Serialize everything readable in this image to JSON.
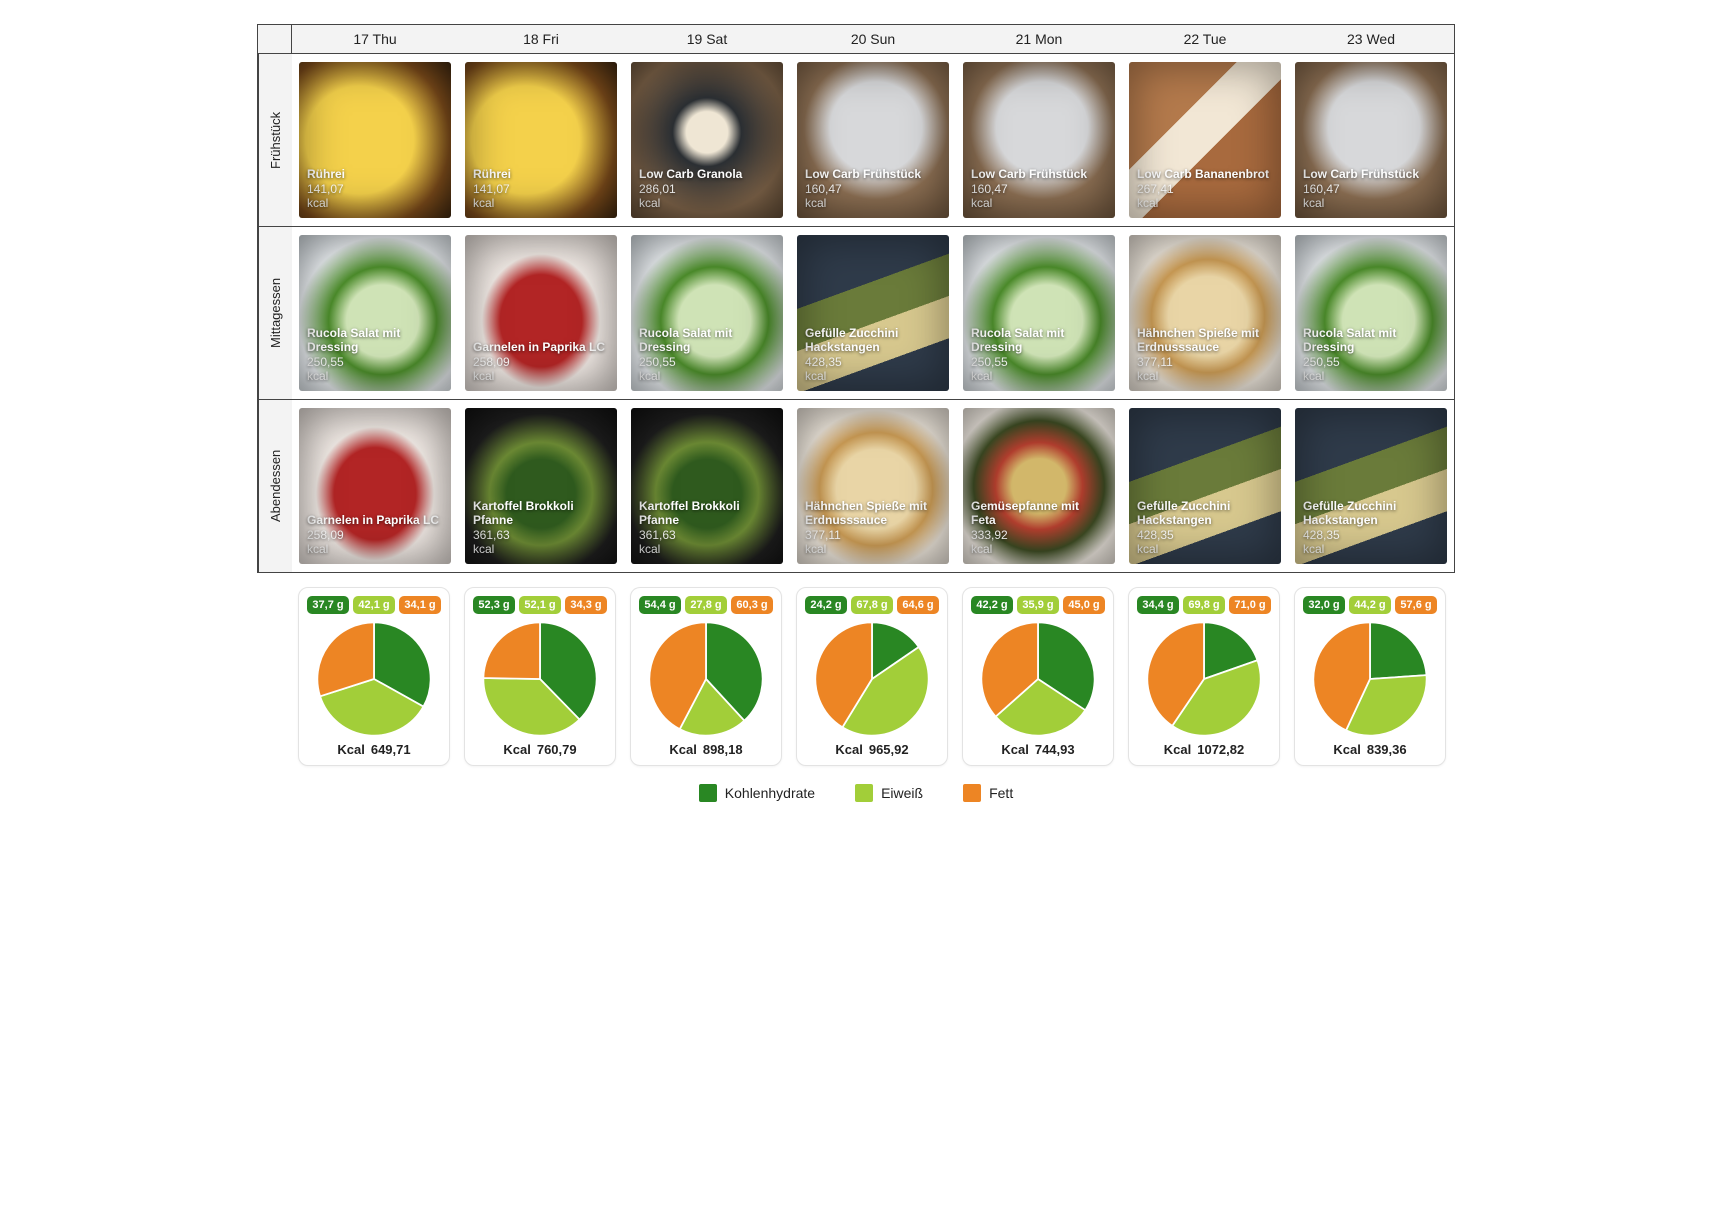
{
  "row_labels": [
    "Frühstück",
    "Mittagessen",
    "Abendessen"
  ],
  "kcal_unit": "kcal",
  "kcal_label": "Kcal",
  "legend": {
    "carb": "Kohlenhydrate",
    "protein": "Eiweiß",
    "fat": "Fett"
  },
  "colors": {
    "carb": "#298723",
    "protein": "#a2ce39",
    "fat": "#ed8524"
  },
  "days": [
    {
      "header": "17 Thu",
      "meals": [
        {
          "name": "Rührei",
          "kcal": "141,07",
          "bg": "bg-ruhrei"
        },
        {
          "name": "Rucola Salat mit Dressing",
          "kcal": "250,55",
          "bg": "bg-rucola"
        },
        {
          "name": "Garnelen in Paprika LC",
          "kcal": "258,09",
          "bg": "bg-garnelen"
        }
      ],
      "macros": {
        "carb_g": "37,7 g",
        "protein_g": "42,1 g",
        "fat_g": "34,1 g",
        "carb": 37.7,
        "protein": 42.1,
        "fat": 34.1
      },
      "kcal_total": "649,71"
    },
    {
      "header": "18 Fri",
      "meals": [
        {
          "name": "Rührei",
          "kcal": "141,07",
          "bg": "bg-ruhrei"
        },
        {
          "name": "Garnelen in Paprika LC",
          "kcal": "258,09",
          "bg": "bg-garnelen"
        },
        {
          "name": "Kartoffel Brokkoli Pfanne",
          "kcal": "361,63",
          "bg": "bg-brokkoli"
        }
      ],
      "macros": {
        "carb_g": "52,3 g",
        "protein_g": "52,1 g",
        "fat_g": "34,3 g",
        "carb": 52.3,
        "protein": 52.1,
        "fat": 34.3
      },
      "kcal_total": "760,79"
    },
    {
      "header": "19 Sat",
      "meals": [
        {
          "name": "Low Carb Granola",
          "kcal": "286,01",
          "bg": "bg-granola"
        },
        {
          "name": "Rucola Salat mit Dressing",
          "kcal": "250,55",
          "bg": "bg-rucola"
        },
        {
          "name": "Kartoffel Brokkoli Pfanne",
          "kcal": "361,63",
          "bg": "bg-brokkoli"
        }
      ],
      "macros": {
        "carb_g": "54,4 g",
        "protein_g": "27,8 g",
        "fat_g": "60,3 g",
        "carb": 54.4,
        "protein": 27.8,
        "fat": 60.3
      },
      "kcal_total": "898,18"
    },
    {
      "header": "20 Sun",
      "meals": [
        {
          "name": "Low Carb Frühstück",
          "kcal": "160,47",
          "bg": "bg-lcfruh"
        },
        {
          "name": "Gefülle Zucchini Hackstangen",
          "kcal": "428,35",
          "bg": "bg-zucchini"
        },
        {
          "name": "Hähnchen Spieße mit Erdnusssauce",
          "kcal": "377,11",
          "bg": "bg-spiesse"
        }
      ],
      "macros": {
        "carb_g": "24,2 g",
        "protein_g": "67,8 g",
        "fat_g": "64,6 g",
        "carb": 24.2,
        "protein": 67.8,
        "fat": 64.6
      },
      "kcal_total": "965,92"
    },
    {
      "header": "21 Mon",
      "meals": [
        {
          "name": "Low Carb Frühstück",
          "kcal": "160,47",
          "bg": "bg-lcfruh"
        },
        {
          "name": "Rucola Salat mit Dressing",
          "kcal": "250,55",
          "bg": "bg-rucola"
        },
        {
          "name": "Gemüsepfanne mit Feta",
          "kcal": "333,92",
          "bg": "bg-gemuese"
        }
      ],
      "macros": {
        "carb_g": "42,2 g",
        "protein_g": "35,9 g",
        "fat_g": "45,0 g",
        "carb": 42.2,
        "protein": 35.9,
        "fat": 45.0
      },
      "kcal_total": "744,93"
    },
    {
      "header": "22 Tue",
      "meals": [
        {
          "name": "Low Carb Bananenbrot",
          "kcal": "267,41",
          "bg": "bg-banbrot"
        },
        {
          "name": "Hähnchen Spieße mit Erdnusssauce",
          "kcal": "377,11",
          "bg": "bg-spiesse"
        },
        {
          "name": "Gefülle Zucchini Hackstangen",
          "kcal": "428,35",
          "bg": "bg-zucchini"
        }
      ],
      "macros": {
        "carb_g": "34,4 g",
        "protein_g": "69,8 g",
        "fat_g": "71,0 g",
        "carb": 34.4,
        "protein": 69.8,
        "fat": 71.0
      },
      "kcal_total": "1072,82"
    },
    {
      "header": "23 Wed",
      "meals": [
        {
          "name": "Low Carb Frühstück",
          "kcal": "160,47",
          "bg": "bg-lcfruh"
        },
        {
          "name": "Rucola Salat mit Dressing",
          "kcal": "250,55",
          "bg": "bg-rucola"
        },
        {
          "name": "Gefülle Zucchini Hackstangen",
          "kcal": "428,35",
          "bg": "bg-zucchini"
        }
      ],
      "macros": {
        "carb_g": "32,0 g",
        "protein_g": "44,2 g",
        "fat_g": "57,6 g",
        "carb": 32.0,
        "protein": 44.2,
        "fat": 57.6
      },
      "kcal_total": "839,36"
    }
  ],
  "chart_data": {
    "type": "pie",
    "series_labels": [
      "Kohlenhydrate",
      "Eiweiß",
      "Fett"
    ],
    "unit": "g",
    "days": [
      {
        "label": "17 Thu",
        "values": [
          37.7,
          42.1,
          34.1
        ],
        "kcal": 649.71
      },
      {
        "label": "18 Fri",
        "values": [
          52.3,
          52.1,
          34.3
        ],
        "kcal": 760.79
      },
      {
        "label": "19 Sat",
        "values": [
          54.4,
          27.8,
          60.3
        ],
        "kcal": 898.18
      },
      {
        "label": "20 Sun",
        "values": [
          24.2,
          67.8,
          64.6
        ],
        "kcal": 965.92
      },
      {
        "label": "21 Mon",
        "values": [
          42.2,
          35.9,
          45.0
        ],
        "kcal": 744.93
      },
      {
        "label": "22 Tue",
        "values": [
          34.4,
          69.8,
          71.0
        ],
        "kcal": 1072.82
      },
      {
        "label": "23 Wed",
        "values": [
          32.0,
          44.2,
          57.6
        ],
        "kcal": 839.36
      }
    ]
  }
}
